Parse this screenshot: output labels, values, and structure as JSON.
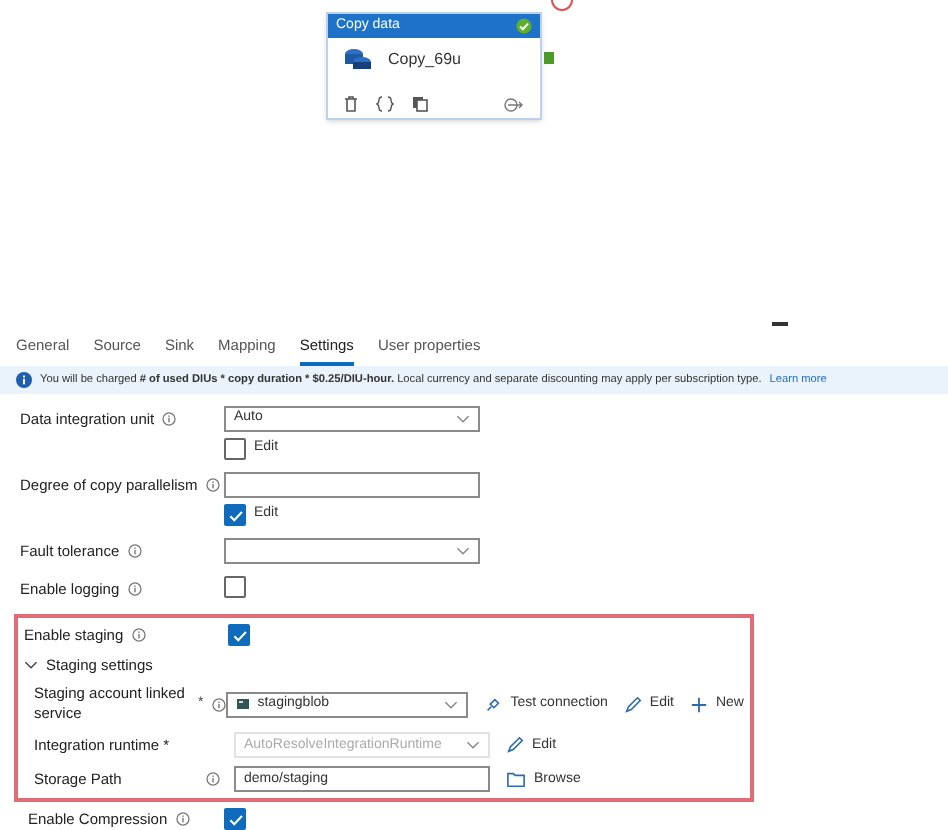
{
  "node": {
    "header": "Copy data",
    "name": "Copy_69u",
    "validated": true
  },
  "tabs": [
    {
      "label": "General",
      "selected": false
    },
    {
      "label": "Source",
      "selected": false
    },
    {
      "label": "Sink",
      "selected": false
    },
    {
      "label": "Mapping",
      "selected": false
    },
    {
      "label": "Settings",
      "selected": true
    },
    {
      "label": "User properties",
      "selected": false
    }
  ],
  "banner": {
    "text": "You will be charged **# of used DIUs * copy duration * $0.25/DIU-hour.** Local currency and separate discounting may apply per subscription type.",
    "link": "Learn more"
  },
  "fields": [
    {
      "kind": "select",
      "label": "Data integration unit",
      "info": true,
      "value": "Auto",
      "edit": {
        "label": "Edit",
        "checked": false
      }
    },
    {
      "kind": "text",
      "label": "Degree of copy parallelism",
      "info": true,
      "edit": {
        "label": "Edit",
        "checked": true
      }
    },
    {
      "kind": "select",
      "label": "Fault tolerance",
      "info": true
    },
    {
      "kind": "checkbox",
      "label": "Enable logging",
      "info": true,
      "checked": false
    }
  ],
  "staging": {
    "highlighted": true,
    "enable": {
      "label": "Enable staging",
      "info": true,
      "checked": true
    },
    "section": {
      "label": "Staging settings",
      "expanded": true
    },
    "rows": [
      {
        "kind": "select",
        "label": "Staging account linked service",
        "required": "*",
        "info": true,
        "value": "stagingblob",
        "disabled": false,
        "actions": [
          {
            "kind": "test",
            "label": "Test connection"
          },
          {
            "kind": "edit",
            "label": "Edit"
          },
          {
            "kind": "new",
            "label": "New"
          }
        ]
      },
      {
        "kind": "select",
        "label": "Integration runtime *",
        "info": false,
        "value": "AutoResolveIntegrationRuntime",
        "disabled": true,
        "actions": [
          {
            "kind": "edit",
            "label": "Edit"
          }
        ]
      },
      {
        "kind": "text",
        "label": "Storage Path",
        "info": true,
        "value": "demo/staging",
        "disabled": false,
        "actions": [
          {
            "kind": "browse",
            "label": "Browse"
          }
        ]
      }
    ]
  },
  "after": [
    {
      "kind": "checkbox",
      "label": "Enable Compression",
      "info": true,
      "checked": true
    }
  ]
}
